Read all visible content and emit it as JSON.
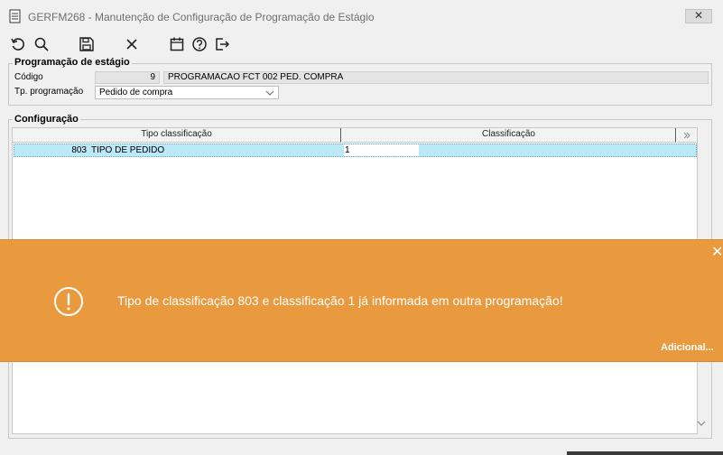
{
  "window": {
    "title": "GERFM268 - Manutenção de Configuração de Programação de Estágio",
    "close_glyph": "✕"
  },
  "toolbar": {
    "buttons": [
      {
        "icon": "undo-icon"
      },
      {
        "icon": "search-icon"
      },
      {
        "icon": "save-icon"
      },
      {
        "icon": "close-icon"
      },
      {
        "icon": "calendar-icon"
      },
      {
        "icon": "help-icon"
      },
      {
        "icon": "exit-icon"
      }
    ]
  },
  "programacao": {
    "legend": "Programação de estágio",
    "codigo_label": "Código",
    "codigo_value": "9",
    "descricao_value": "PROGRAMACAO FCT 002 PED. COMPRA",
    "tp_label": "Tp. programação",
    "tp_value": "Pedido de compra"
  },
  "configuracao": {
    "legend": "Configuração",
    "columns": [
      "Tipo classificação",
      "Classificação"
    ],
    "rows": [
      {
        "tipo_codigo": "803",
        "tipo_descricao": "TIPO DE PEDIDO",
        "classificacao": "1"
      }
    ]
  },
  "toast": {
    "message": "Tipo de classificação 803 e classificação 1 já informada em outra programação!",
    "more_link": "Adicional...",
    "close_glyph": "✕",
    "color": "#ea9a3e"
  }
}
